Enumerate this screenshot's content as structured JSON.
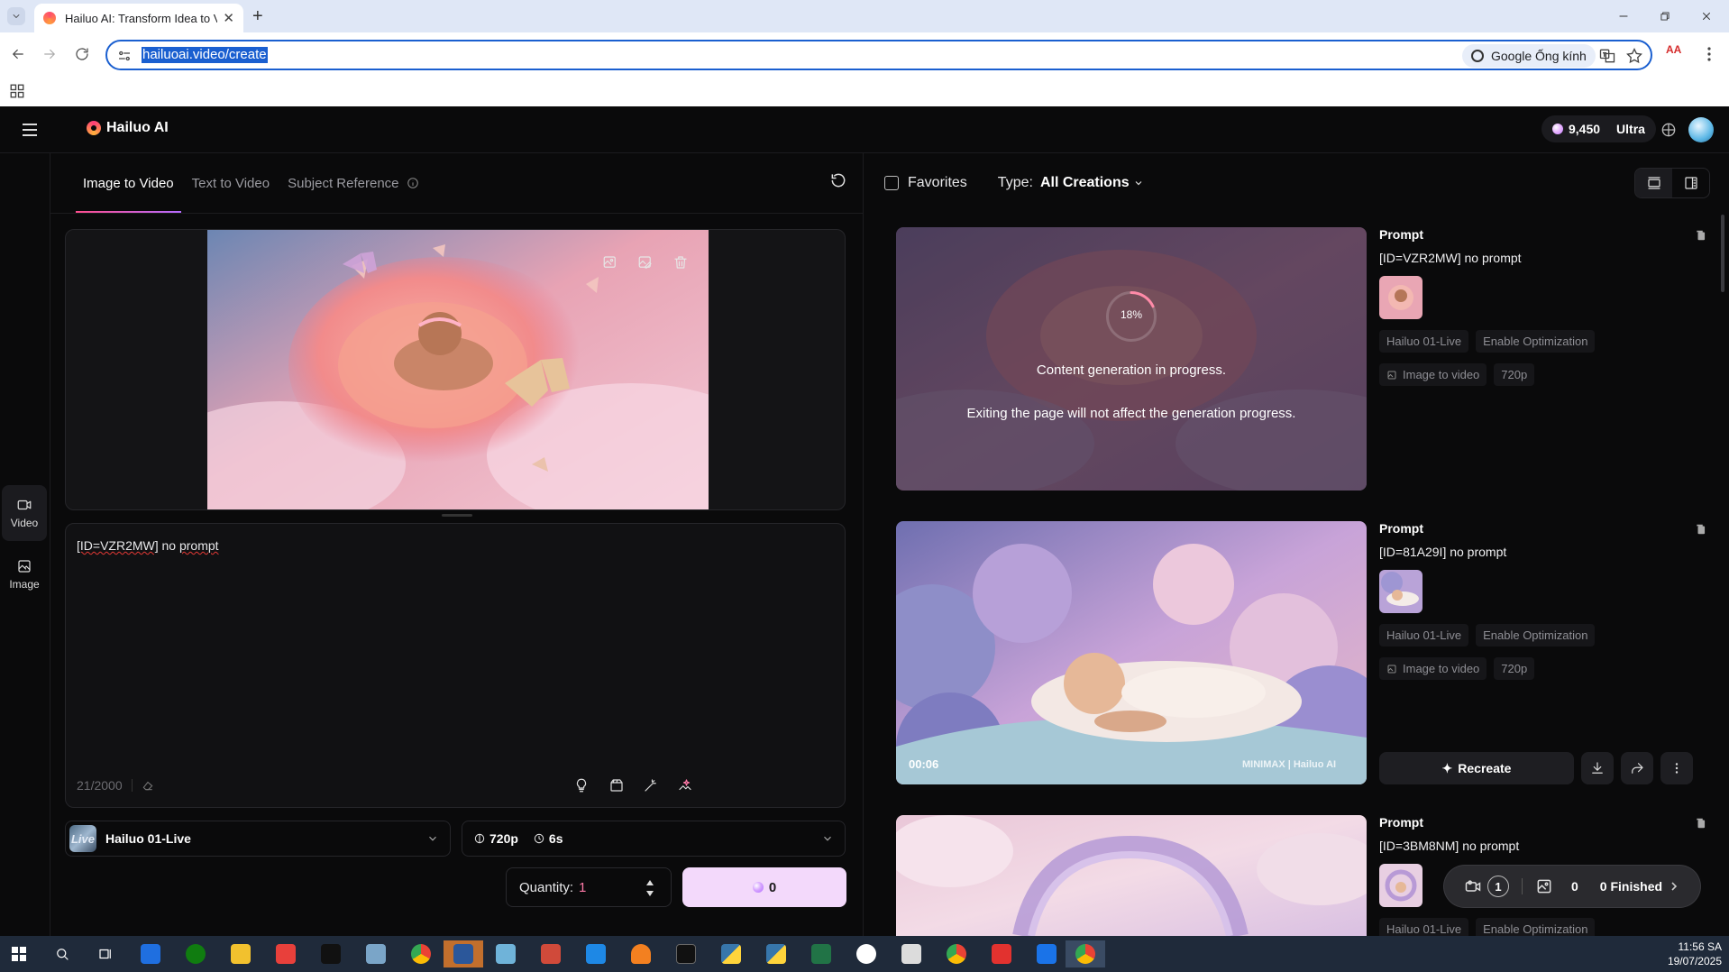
{
  "browser": {
    "tab_title": "Hailuo AI: Transform Idea to Vis",
    "url": "hailuoai.video/create",
    "lens_label": "Google Ống kính",
    "ext_badge": "AA"
  },
  "header": {
    "logo": "Hailuo AI",
    "credits": "9,450",
    "plan": "Ultra"
  },
  "sidenav": {
    "video": "Video",
    "image": "Image"
  },
  "modes": {
    "tabs": [
      "Image to Video",
      "Text to Video",
      "Subject Reference"
    ],
    "active": "Image to Video"
  },
  "prompt": {
    "text_id": "[ID=VZR2MW]",
    "text_rest": " no ",
    "text_word": "prompt",
    "counter": "21/2000"
  },
  "settings": {
    "model_thumb": "Live",
    "model": "Hailuo 01-Live",
    "resolution": "720p",
    "duration": "6s",
    "quantity_label": "Quantity:",
    "quantity": "1",
    "generate_cost": "0"
  },
  "feed": {
    "favorites": "Favorites",
    "type_label": "Type:",
    "type_value": "All Creations",
    "items": [
      {
        "heading": "Prompt",
        "prompt": "[ID=VZR2MW] no prompt",
        "tags": [
          "Hailuo 01-Live",
          "Enable Optimization"
        ],
        "tags2": [
          "Image to video",
          "720p"
        ],
        "progress_pct": "18%",
        "progress_value": 0.18,
        "msg1": "Content generation in progress.",
        "msg2": "Exiting the page will not affect the generation progress."
      },
      {
        "heading": "Prompt",
        "prompt": "[ID=81A29I] no prompt",
        "tags": [
          "Hailuo 01-Live",
          "Enable Optimization"
        ],
        "tags2": [
          "Image to video",
          "720p"
        ],
        "duration": "00:06",
        "watermark": "MINIMAX | Hailuo AI",
        "recreate": "Recreate"
      },
      {
        "heading": "Prompt",
        "prompt": "[ID=3BM8NM] no prompt",
        "tags": [
          "Hailuo 01-Live",
          "Enable Optimization"
        ]
      }
    ]
  },
  "queue": {
    "processing": "1",
    "queued": "0",
    "finished": "0 Finished"
  },
  "taskbar": {
    "time": "11:56 SA",
    "date": "19/07/2025"
  },
  "colors": {
    "accent_pink": "#ff7aa8",
    "generate_bg": "#f3d9fb",
    "omnibox_border": "#1a5fd0"
  }
}
